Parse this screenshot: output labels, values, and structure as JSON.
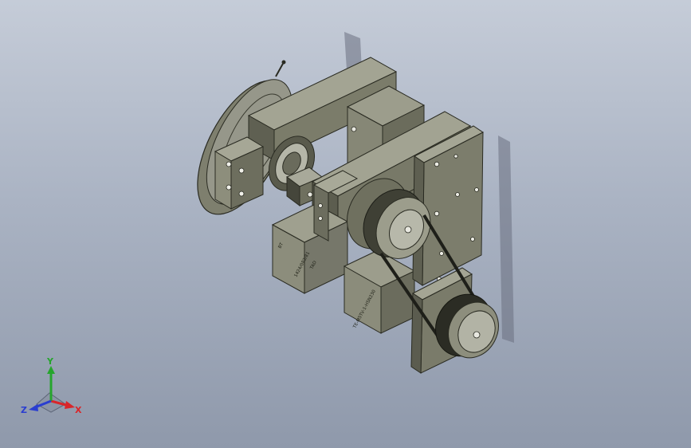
{
  "viewport": {
    "background_top": "#c5ccd8",
    "background_bottom": "#8f99ab",
    "model_color": "#8a8b79",
    "model_dark": "#56574a"
  },
  "model": {
    "motor_label_upper": "BT",
    "motor_label_main": "1424/083/81",
    "motor_label_side": "TAD",
    "motor_label_lower": "TE-M5TV-1-HSN230"
  },
  "triad": {
    "x_label": "X",
    "y_label": "Y",
    "z_label": "Z",
    "x_color": "#d9262a",
    "y_color": "#26a52d",
    "z_color": "#2a3ed0"
  }
}
